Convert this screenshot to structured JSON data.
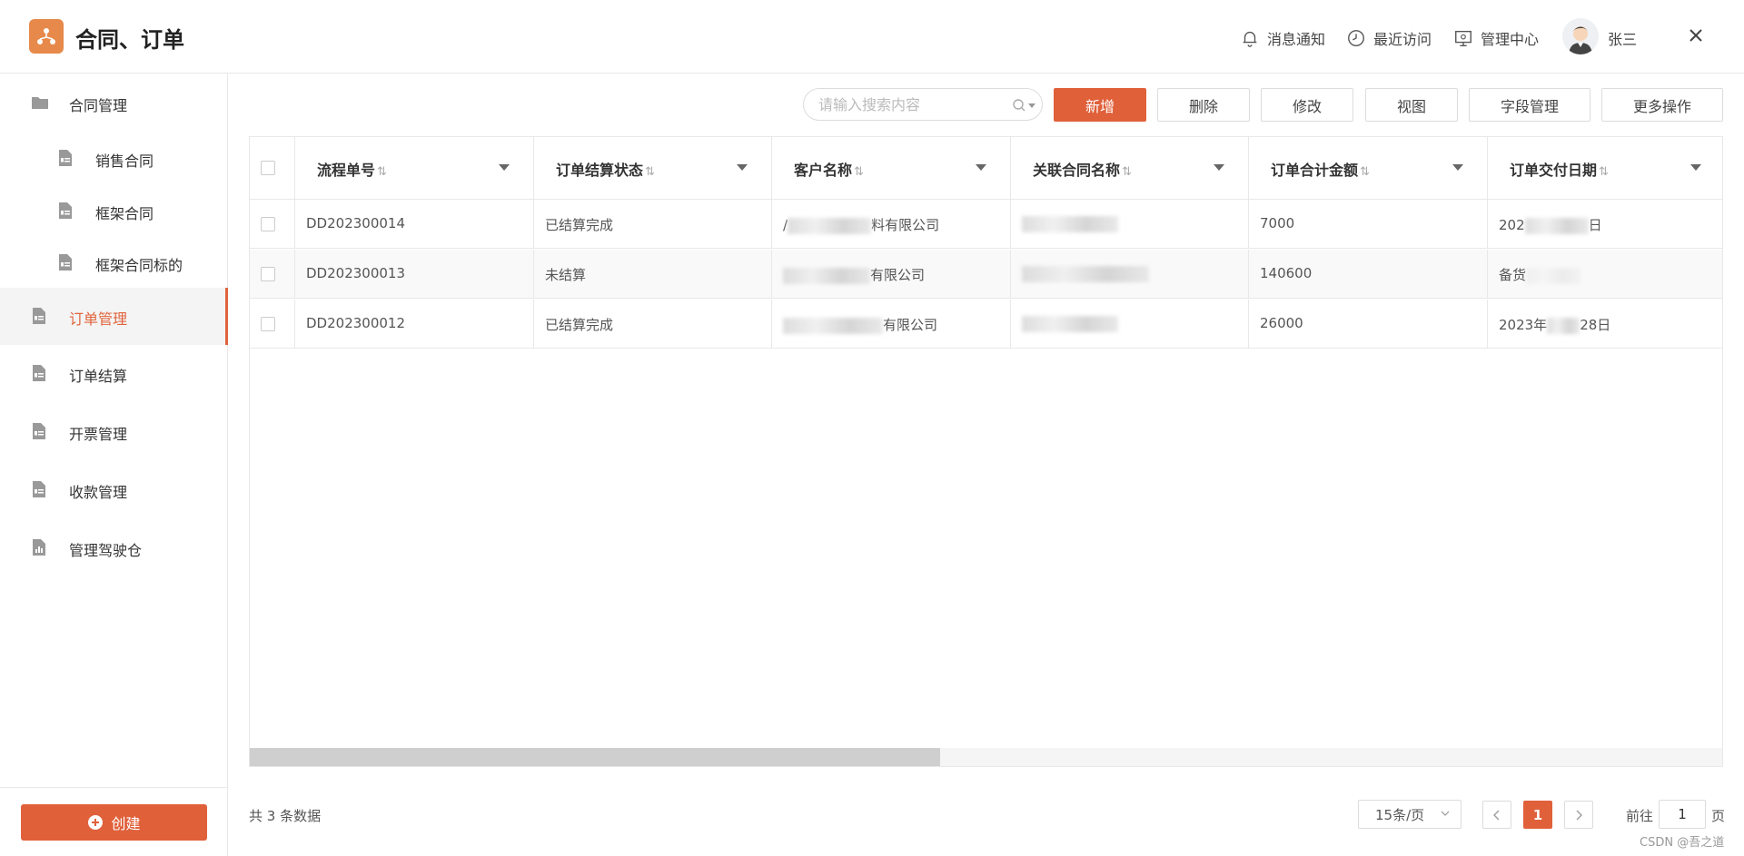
{
  "app": {
    "title": "合同、订单",
    "brand_color": "#e6894a",
    "accent": "#e0603a"
  },
  "header": {
    "notifications": "消息通知",
    "recent": "最近访问",
    "admin_center": "管理中心",
    "user_name": "张三"
  },
  "sidebar": {
    "items": [
      {
        "label": "合同管理",
        "icon": "folder-icon"
      },
      {
        "label": "销售合同",
        "icon": "document-icon"
      },
      {
        "label": "框架合同",
        "icon": "document-icon"
      },
      {
        "label": "框架合同标的",
        "icon": "document-icon"
      },
      {
        "label": "订单管理",
        "icon": "document-icon",
        "active": true
      },
      {
        "label": "订单结算",
        "icon": "document-icon"
      },
      {
        "label": "开票管理",
        "icon": "document-icon"
      },
      {
        "label": "收款管理",
        "icon": "document-icon"
      },
      {
        "label": "管理驾驶仓",
        "icon": "chart-icon"
      }
    ],
    "create_label": "创建"
  },
  "toolbar": {
    "search_placeholder": "请输入搜索内容",
    "add": "新增",
    "delete": "删除",
    "edit": "修改",
    "view": "视图",
    "field_manage": "字段管理",
    "more": "更多操作"
  },
  "table": {
    "columns": [
      "流程单号",
      "订单结算状态",
      "客户名称",
      "关联合同名称",
      "订单合计金额",
      "订单交付日期"
    ],
    "sort_glyph": "⇅",
    "rows": [
      {
        "id": "DD202300014",
        "status": "已结算完成",
        "customer_prefix": "/",
        "customer_suffix": "料有限公司",
        "amount": "7000",
        "date_prefix": "202",
        "date_suffix": "日"
      },
      {
        "id": "DD202300013",
        "status": "未结算",
        "customer_prefix": "",
        "customer_suffix": "有限公司",
        "amount": "140600",
        "date_prefix": "备货",
        "date_suffix": ""
      },
      {
        "id": "DD202300012",
        "status": "已结算完成",
        "customer_prefix": "",
        "customer_suffix": "有限公司",
        "amount": "26000",
        "date_prefix": "2023年",
        "date_suffix": "28日"
      }
    ]
  },
  "footer": {
    "total": "共 3 条数据",
    "page_size": "15条/页",
    "current_page": "1",
    "goto_prefix": "前往",
    "goto_value": "1",
    "goto_suffix": "页",
    "watermark": "CSDN @吾之道"
  }
}
